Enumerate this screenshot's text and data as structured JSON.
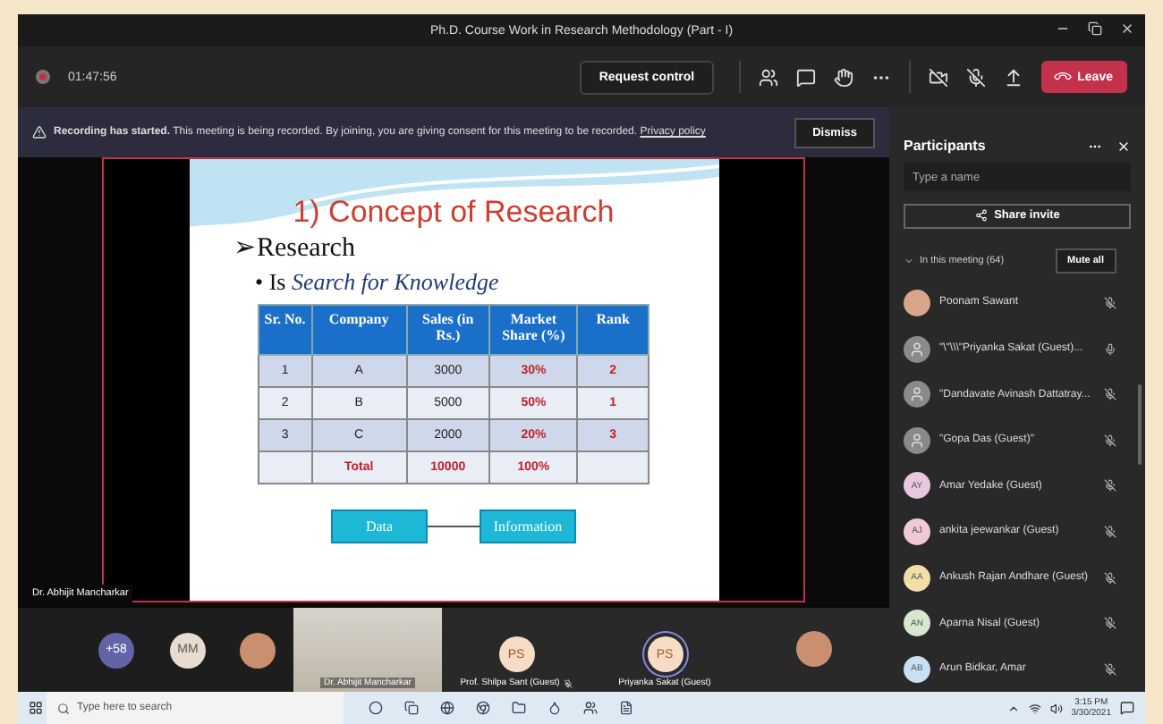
{
  "window": {
    "title": "Ph.D. Course Work in Research Methodology (Part - I)"
  },
  "toolbar": {
    "timer": "01:47:56",
    "request_control": "Request control",
    "leave": "Leave"
  },
  "banner": {
    "lead": "Recording has started.",
    "message": "This meeting is being recorded. By joining, you are giving consent for this meeting to be recorded.",
    "link": "Privacy policy",
    "dismiss": "Dismiss"
  },
  "slide": {
    "title": "1) Concept of Research",
    "heading_marker": "➢",
    "heading": "Research",
    "bullet_marker": "•",
    "bullet_prefix": "Is",
    "bullet_emphasis": "Search for Knowledge",
    "table": {
      "columns": [
        "Sr. No.",
        "Company",
        "Sales (in Rs.)",
        "Market Share (%)",
        "Rank"
      ],
      "rows": [
        {
          "kind": "data",
          "cells": [
            "1",
            "A",
            "3000",
            "30%",
            "2"
          ]
        },
        {
          "kind": "data",
          "cells": [
            "2",
            "B",
            "5000",
            "50%",
            "1"
          ]
        },
        {
          "kind": "data",
          "cells": [
            "3",
            "C",
            "2000",
            "20%",
            "3"
          ]
        },
        {
          "kind": "total",
          "cells": [
            "",
            "Total",
            "10000",
            "100%",
            ""
          ]
        }
      ]
    },
    "diagram": [
      "Data",
      "Information"
    ]
  },
  "presenter_label": "Dr. Abhijit Mancharkar",
  "tiles": [
    {
      "kind": "count",
      "text": "+58"
    },
    {
      "kind": "initials",
      "text": "MM"
    },
    {
      "kind": "photo"
    },
    {
      "kind": "video",
      "name": "Dr. Abhijit Mancharkar"
    },
    {
      "kind": "initials_tile",
      "text": "PS",
      "name": "Prof. Shilpa Sant (Guest)",
      "muted": true,
      "speaking": false
    },
    {
      "kind": "initials_tile",
      "text": "PS",
      "name": "Priyanka Sakat (Guest)",
      "muted": false,
      "speaking": true
    },
    {
      "kind": "photo_tile"
    }
  ],
  "participants": {
    "title": "Participants",
    "search_placeholder": "Type a name",
    "share_invite": "Share invite",
    "section": "In this meeting (64)",
    "mute_all": "Mute all",
    "items": [
      {
        "kind": "photo",
        "name": "Poonam Sawant",
        "muted": true
      },
      {
        "kind": "generic",
        "name": "\"\\\"\\\\\\\"Priyanka Sakat (Guest)...",
        "muted": false
      },
      {
        "kind": "generic",
        "name": "\"Dandavate Avinash Dattatray...",
        "muted": true
      },
      {
        "kind": "generic",
        "name": "\"Gopa Das (Guest)\"",
        "muted": true
      },
      {
        "kind": "initials",
        "initials": "AY",
        "color": "#e8c8e0",
        "name": "Amar Yedake (Guest)",
        "muted": true
      },
      {
        "kind": "initials",
        "initials": "AJ",
        "color": "#f0c8d8",
        "name": "ankita jeewankar (Guest)",
        "muted": true
      },
      {
        "kind": "initials",
        "initials": "AA",
        "color": "#f0e0a8",
        "name": "Ankush Rajan Andhare (Guest)",
        "muted": true
      },
      {
        "kind": "initials",
        "initials": "AN",
        "color": "#d8e8d0",
        "name": "Aparna Nisal (Guest)",
        "muted": true
      },
      {
        "kind": "initials",
        "initials": "AB",
        "color": "#c8e0f0",
        "name": "Arun Bidkar, Amar",
        "muted": true
      }
    ]
  },
  "taskbar": {
    "search_placeholder": "Type here to search",
    "time": "3:15 PM",
    "date": "3/30/2021"
  }
}
